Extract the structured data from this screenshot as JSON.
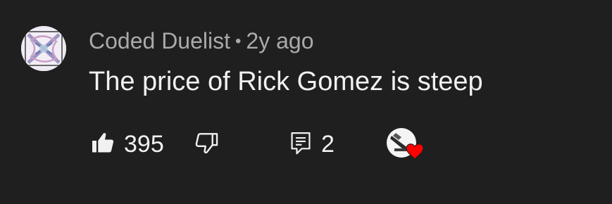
{
  "comment": {
    "author": "Coded Duelist",
    "separator": "•",
    "age": "2y ago",
    "text": "The price of Rick Gomez is steep",
    "likes": "395",
    "replies": "2"
  },
  "icons": {
    "like": "thumbs-up-icon",
    "dislike": "thumbs-down-icon",
    "reply": "reply-comment-icon",
    "heart": "creator-heart-icon"
  },
  "colors": {
    "background": "#1f1f1f",
    "meta_text": "#aaaaaa",
    "primary_text": "#f1f1f1",
    "heart": "#ff0000"
  }
}
